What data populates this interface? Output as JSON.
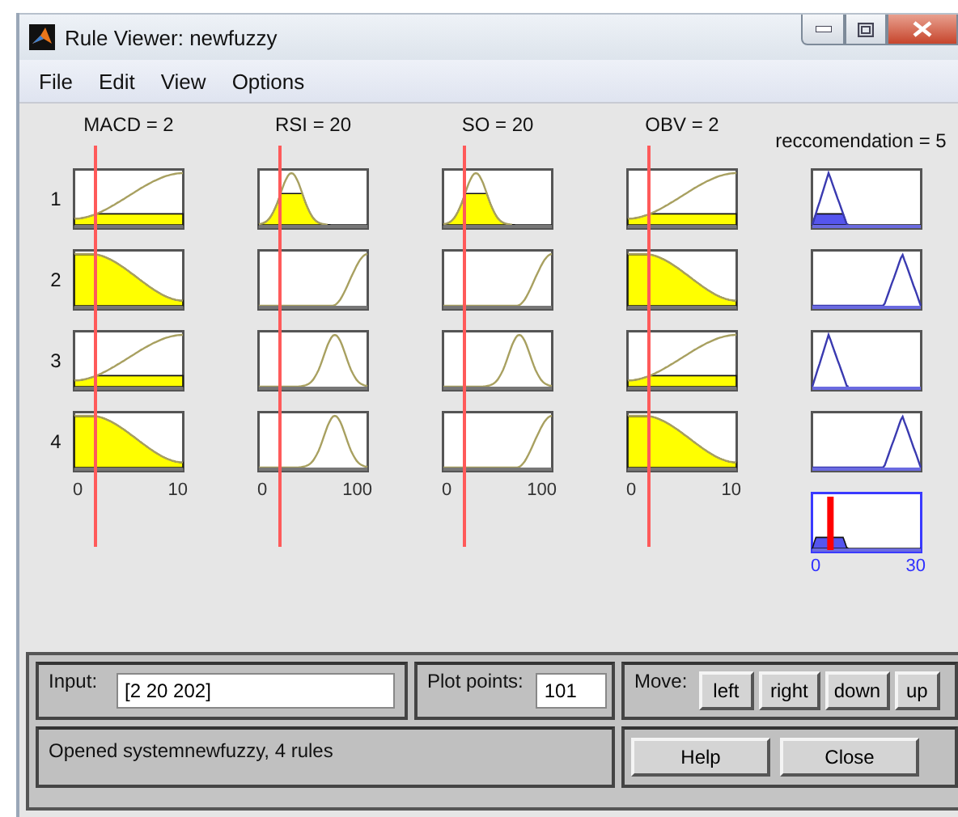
{
  "window": {
    "title": "Rule Viewer: newfuzzy"
  },
  "menu": [
    "File",
    "Edit",
    "View",
    "Options"
  ],
  "rule_numbers": [
    "1",
    "2",
    "3",
    "4"
  ],
  "inputs": [
    {
      "label": "MACD = 2",
      "level": 0.2,
      "min": "0",
      "max": "10",
      "rules": [
        {
          "kind": "s-rise"
        },
        {
          "kind": "z-fall"
        },
        {
          "kind": "s-rise"
        },
        {
          "kind": "z-fall"
        }
      ]
    },
    {
      "label": "RSI = 20",
      "level": 0.2,
      "min": "0",
      "max": "100",
      "rules": [
        {
          "kind": "bell-low"
        },
        {
          "kind": "s-high"
        },
        {
          "kind": "bell-high"
        },
        {
          "kind": "bell-high"
        }
      ]
    },
    {
      "label": "SO = 20",
      "level": 0.2,
      "min": "0",
      "max": "100",
      "rules": [
        {
          "kind": "bell-low"
        },
        {
          "kind": "s-high"
        },
        {
          "kind": "bell-high"
        },
        {
          "kind": "s-high"
        }
      ]
    },
    {
      "label": "OBV = 2",
      "level": 0.2,
      "min": "0",
      "max": "10",
      "rules": [
        {
          "kind": "s-rise"
        },
        {
          "kind": "z-fall"
        },
        {
          "kind": "s-rise"
        },
        {
          "kind": "z-fall"
        }
      ]
    }
  ],
  "output": {
    "label": "reccomendation = 5",
    "level": 0.1667,
    "min": "0",
    "max": "30",
    "rules": [
      {
        "kind": "tri-low"
      },
      {
        "kind": "tri-high"
      },
      {
        "kind": "tri-low"
      },
      {
        "kind": "tri-high"
      }
    ]
  },
  "controls": {
    "input_label": "Input:",
    "input_value": "[2 20 202]",
    "plot_points_label": "Plot points:",
    "plot_points_value": "101",
    "move_label": "Move:",
    "move_buttons": [
      "left",
      "right",
      "down",
      "up"
    ],
    "status": "Opened systemnewfuzzy, 4 rules",
    "buttons": [
      "Help",
      "Close"
    ]
  }
}
